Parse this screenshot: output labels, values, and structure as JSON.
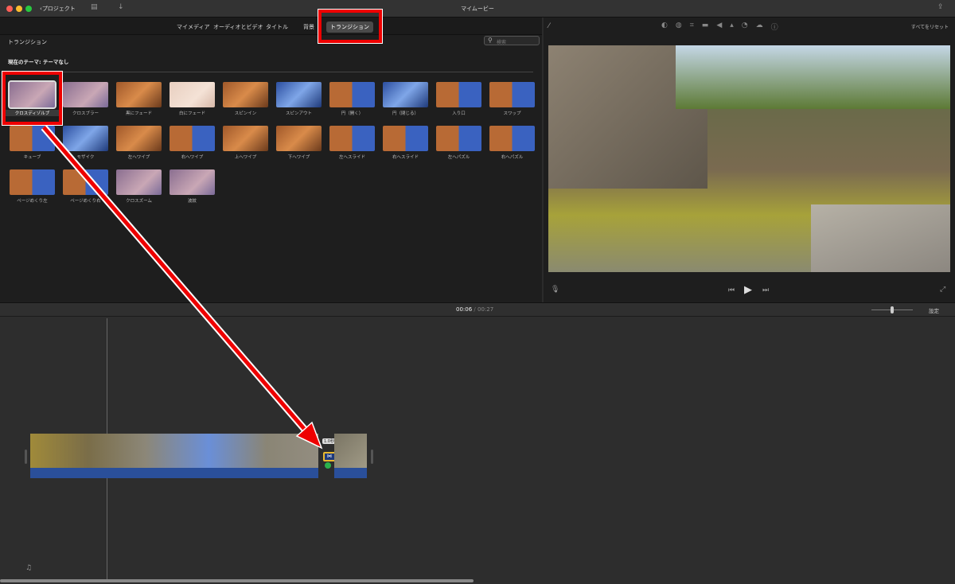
{
  "titlebar": {
    "back": "プロジェクト",
    "title": "マイムービー"
  },
  "tabs": [
    "マイメディア",
    "オーディオとビデオ",
    "タイトル",
    "背景",
    "トランジション"
  ],
  "browser": {
    "header": "トランジション",
    "search_placeholder": "検索",
    "theme": "現在のテーマ: テーマなし"
  },
  "transitions": [
    {
      "label": "クロスディゾルブ",
      "style": "soft"
    },
    {
      "label": "クロスブラー",
      "style": "soft"
    },
    {
      "label": "黒にフェード",
      "style": "orange"
    },
    {
      "label": "白にフェード",
      "style": "pale"
    },
    {
      "label": "スピンイン",
      "style": "orange"
    },
    {
      "label": "スピンアウト",
      "style": "blue"
    },
    {
      "label": "円（開く）",
      "style": "mix"
    },
    {
      "label": "円（閉じる）",
      "style": "blue"
    },
    {
      "label": "入り口",
      "style": "mix"
    },
    {
      "label": "スワップ",
      "style": "mix"
    },
    {
      "label": "キューブ",
      "style": "mix"
    },
    {
      "label": "モザイク",
      "style": "blue"
    },
    {
      "label": "左へワイプ",
      "style": "orange"
    },
    {
      "label": "右へワイプ",
      "style": "mix"
    },
    {
      "label": "上へワイプ",
      "style": "orange"
    },
    {
      "label": "下へワイプ",
      "style": "orange"
    },
    {
      "label": "左へスライド",
      "style": "mix"
    },
    {
      "label": "右へスライド",
      "style": "mix"
    },
    {
      "label": "左へパズル",
      "style": "mix"
    },
    {
      "label": "右へパズル",
      "style": "mix"
    },
    {
      "label": "ページめくり左",
      "style": "mix"
    },
    {
      "label": "ページめくり右",
      "style": "mix"
    },
    {
      "label": "クロスズーム",
      "style": "soft"
    },
    {
      "label": "波紋",
      "style": "soft"
    }
  ],
  "viewer": {
    "reset": "すべてをリセット"
  },
  "timeline": {
    "current": "00:06",
    "separator": "/",
    "total": "00:27",
    "settings": "設定",
    "transition_duration": "1.0秒"
  },
  "colors": {
    "highlight": "#e00000",
    "audio": "#2a4f9a"
  }
}
